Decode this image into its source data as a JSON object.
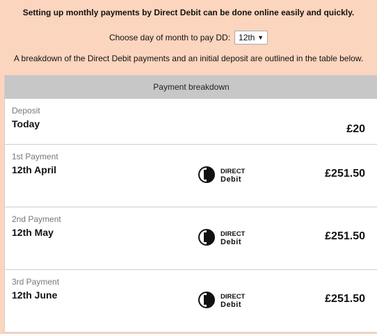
{
  "intro": "Setting up monthly payments by Direct Debit can be done online easily and quickly.",
  "day_select": {
    "label": "Choose day of month to pay DD:",
    "value": "12th"
  },
  "note": "A breakdown of the Direct Debit payments and an initial deposit are outlined in the table below.",
  "table": {
    "header": "Payment breakdown",
    "deposit": {
      "label": "Deposit",
      "date": "Today",
      "amount": "£20"
    },
    "payments": [
      {
        "label": "1st Payment",
        "date": "12th April",
        "amount": "£251.50",
        "logo_top": "DIRECT",
        "logo_bottom": "Debit"
      },
      {
        "label": "2nd Payment",
        "date": "12th May",
        "amount": "£251.50",
        "logo_top": "DIRECT",
        "logo_bottom": "Debit"
      },
      {
        "label": "3rd Payment",
        "date": "12th June",
        "amount": "£251.50",
        "logo_top": "DIRECT",
        "logo_bottom": "Debit"
      }
    ]
  },
  "icons": {
    "logo": "direct-debit-logo",
    "select_arrow": "triangle-down"
  }
}
